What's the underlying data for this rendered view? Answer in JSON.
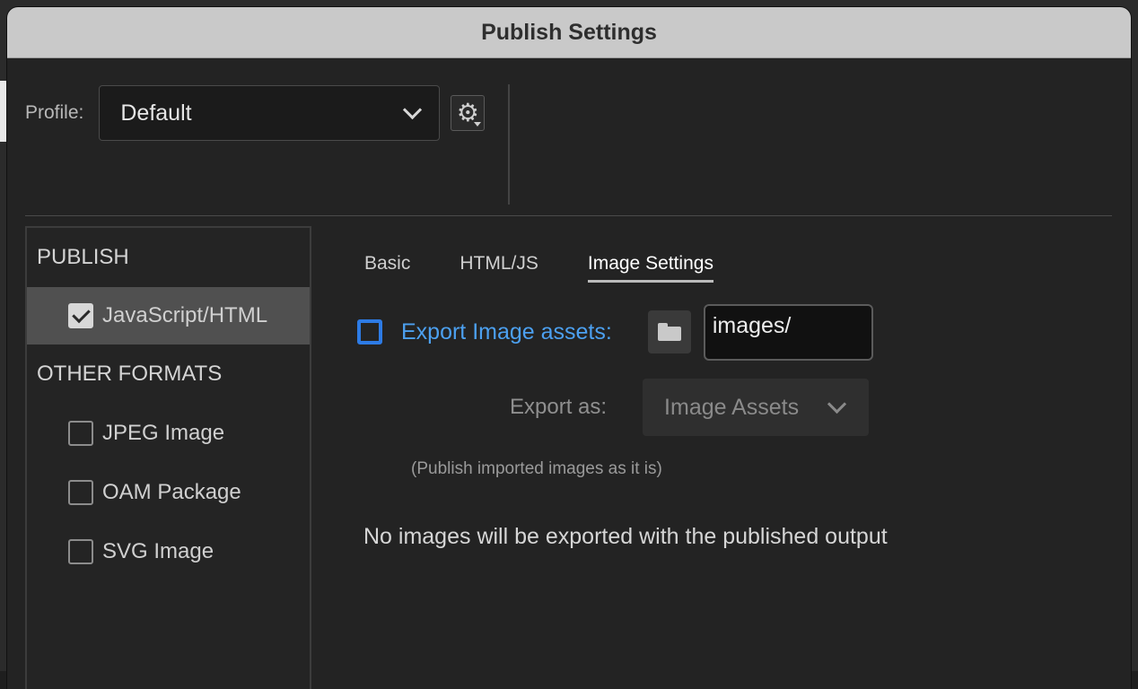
{
  "dialog": {
    "title": "Publish Settings"
  },
  "profile": {
    "label": "Profile:",
    "value": "Default"
  },
  "icons": {
    "gear": "gear-icon",
    "folder": "folder-icon",
    "chevron": "chevron-down-icon",
    "check": "checkmark-icon"
  },
  "sidebar": {
    "publish_header": "PUBLISH",
    "publish_items": [
      {
        "label": "JavaScript/HTML",
        "checked": true,
        "selected": true
      }
    ],
    "other_header": "OTHER FORMATS",
    "other_items": [
      {
        "label": "JPEG Image",
        "checked": false
      },
      {
        "label": "OAM Package",
        "checked": false
      },
      {
        "label": "SVG Image",
        "checked": false
      }
    ]
  },
  "tabs": [
    {
      "label": "Basic",
      "active": false
    },
    {
      "label": "HTML/JS",
      "active": false
    },
    {
      "label": "Image Settings",
      "active": true
    }
  ],
  "image_settings": {
    "export_label": "Export Image assets:",
    "export_checked": false,
    "path_value": "images/",
    "export_as_label": "Export as:",
    "export_as_value": "Image Assets",
    "note": "(Publish imported images as it is)",
    "status_message": "No images will be exported with the published output"
  },
  "colors": {
    "accent": "#2d7be5",
    "accent_text": "#4ca0f0",
    "titlebar": "#c9c9c9",
    "dialog_bg": "#232323",
    "selected_row": "#505050"
  }
}
